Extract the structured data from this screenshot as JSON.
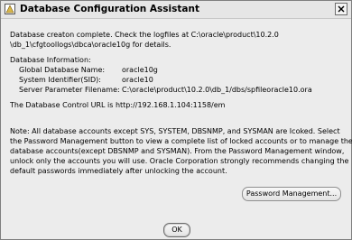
{
  "window": {
    "title": "Database Configuration Assistant"
  },
  "message": {
    "line1": "Database creaton complete. Check the logfiles at C:\\oracle\\product\\10.2.0",
    "line2": "\\db_1\\cfgtoollogs\\dbca\\oracle10g for details."
  },
  "info": {
    "heading": "Database Information:",
    "rows": [
      {
        "label": "Global Database Name:",
        "value": "oracle10g"
      },
      {
        "label": "System Identifier(SID):",
        "value": "oracle10"
      },
      {
        "label": "Server Parameter Filename:",
        "value": "C:\\oracle\\product\\10.2.0\\db_1/dbs/spfileoracle10.ora"
      }
    ]
  },
  "control_url": "The Database Control URL is http://192.168.1.104:1158/em",
  "note": {
    "lines": [
      "Note: All database accounts except SYS, SYSTEM, DBSNMP, and SYSMAN are Icoked. Select",
      "the Password Management button to view a complete list of locked accounts or to manage the",
      "database accounts(except DBSNMP and SYSMAN). From the Password Management window,",
      "unlock only the accounts you will use. Oracle Corporation strongly recommends changing the",
      "default passwords immediately after unlocking the account."
    ]
  },
  "buttons": {
    "password_management": "Password Management...",
    "ok": "OK"
  }
}
